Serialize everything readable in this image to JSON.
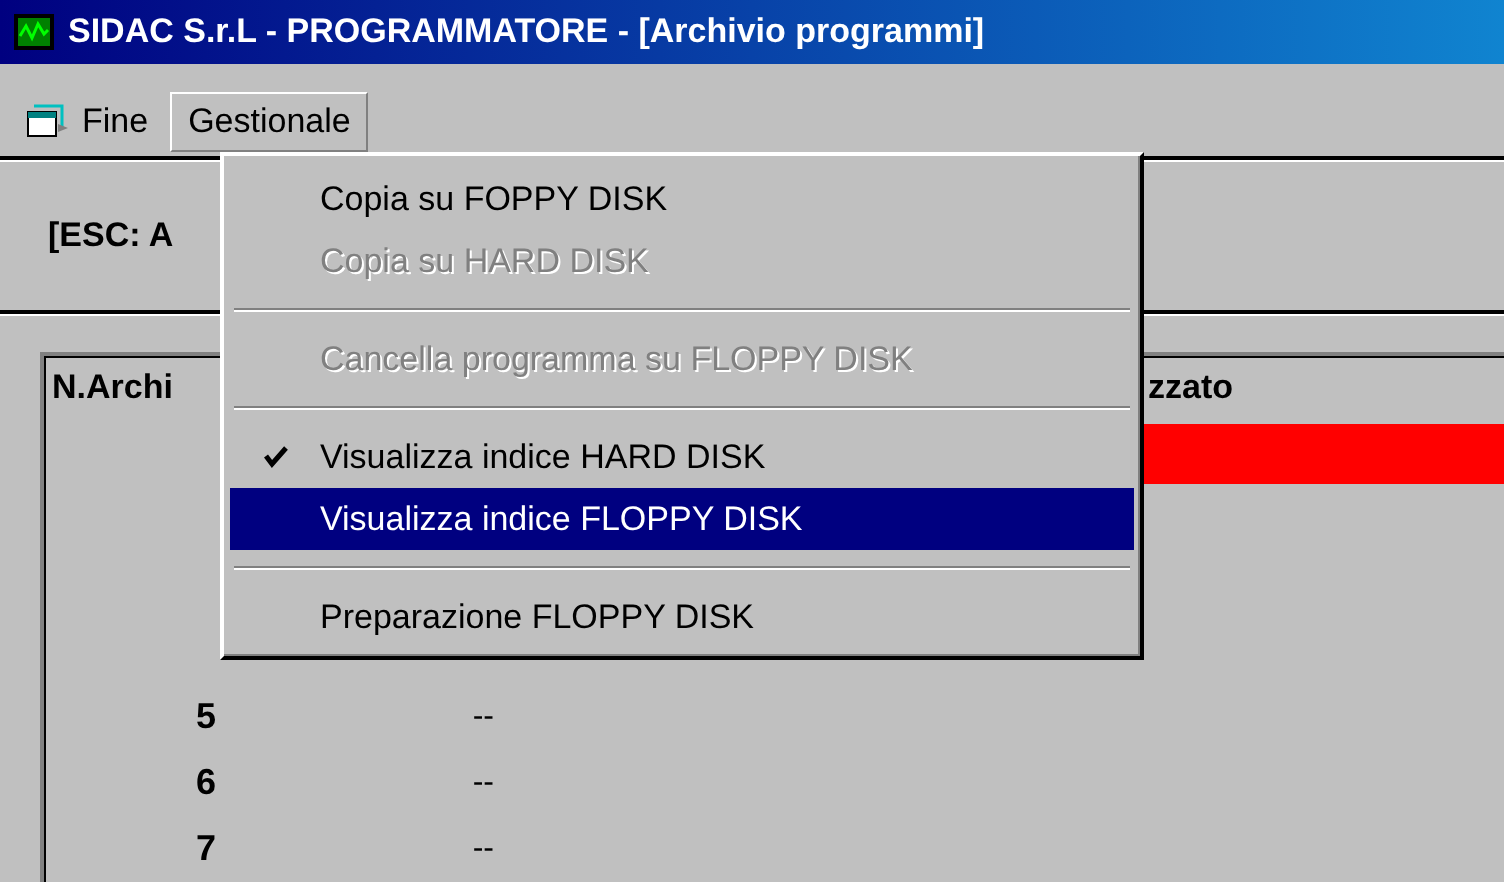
{
  "window": {
    "title": "SIDAC S.r.L - PROGRAMMATORE - [Archivio programmi]"
  },
  "menubar": [
    {
      "label": "Fine",
      "selected": false,
      "icon": true
    },
    {
      "label": "Gestionale",
      "selected": true
    }
  ],
  "dropdown": [
    {
      "kind": "item",
      "label": "Copia su FOPPY DISK",
      "disabled": false,
      "checked": false,
      "selected": false
    },
    {
      "kind": "item",
      "label": "Copia su HARD DISK",
      "disabled": true,
      "checked": false,
      "selected": false
    },
    {
      "kind": "separator"
    },
    {
      "kind": "item",
      "label": "Cancella programma su FLOPPY DISK",
      "disabled": true,
      "checked": false,
      "selected": false
    },
    {
      "kind": "separator"
    },
    {
      "kind": "item",
      "label": "Visualizza indice HARD DISK",
      "disabled": false,
      "checked": true,
      "selected": false
    },
    {
      "kind": "item",
      "label": "Visualizza indice FLOPPY DISK",
      "disabled": false,
      "checked": false,
      "selected": true
    },
    {
      "kind": "separator"
    },
    {
      "kind": "item",
      "label": "Preparazione FLOPPY DISK",
      "disabled": false,
      "checked": false,
      "selected": false
    }
  ],
  "toolbar": {
    "hint": "[ESC: A"
  },
  "table": {
    "columns": [
      "N.Archi",
      "zzato"
    ],
    "rows": [
      {
        "selected": true
      },
      {
        "selected": false
      },
      {
        "selected": false
      },
      {
        "selected": false
      },
      {
        "number": "5",
        "value": "--",
        "selected": false
      },
      {
        "number": "6",
        "value": "--",
        "selected": false
      },
      {
        "number": "7",
        "value": "--",
        "selected": false
      }
    ]
  }
}
